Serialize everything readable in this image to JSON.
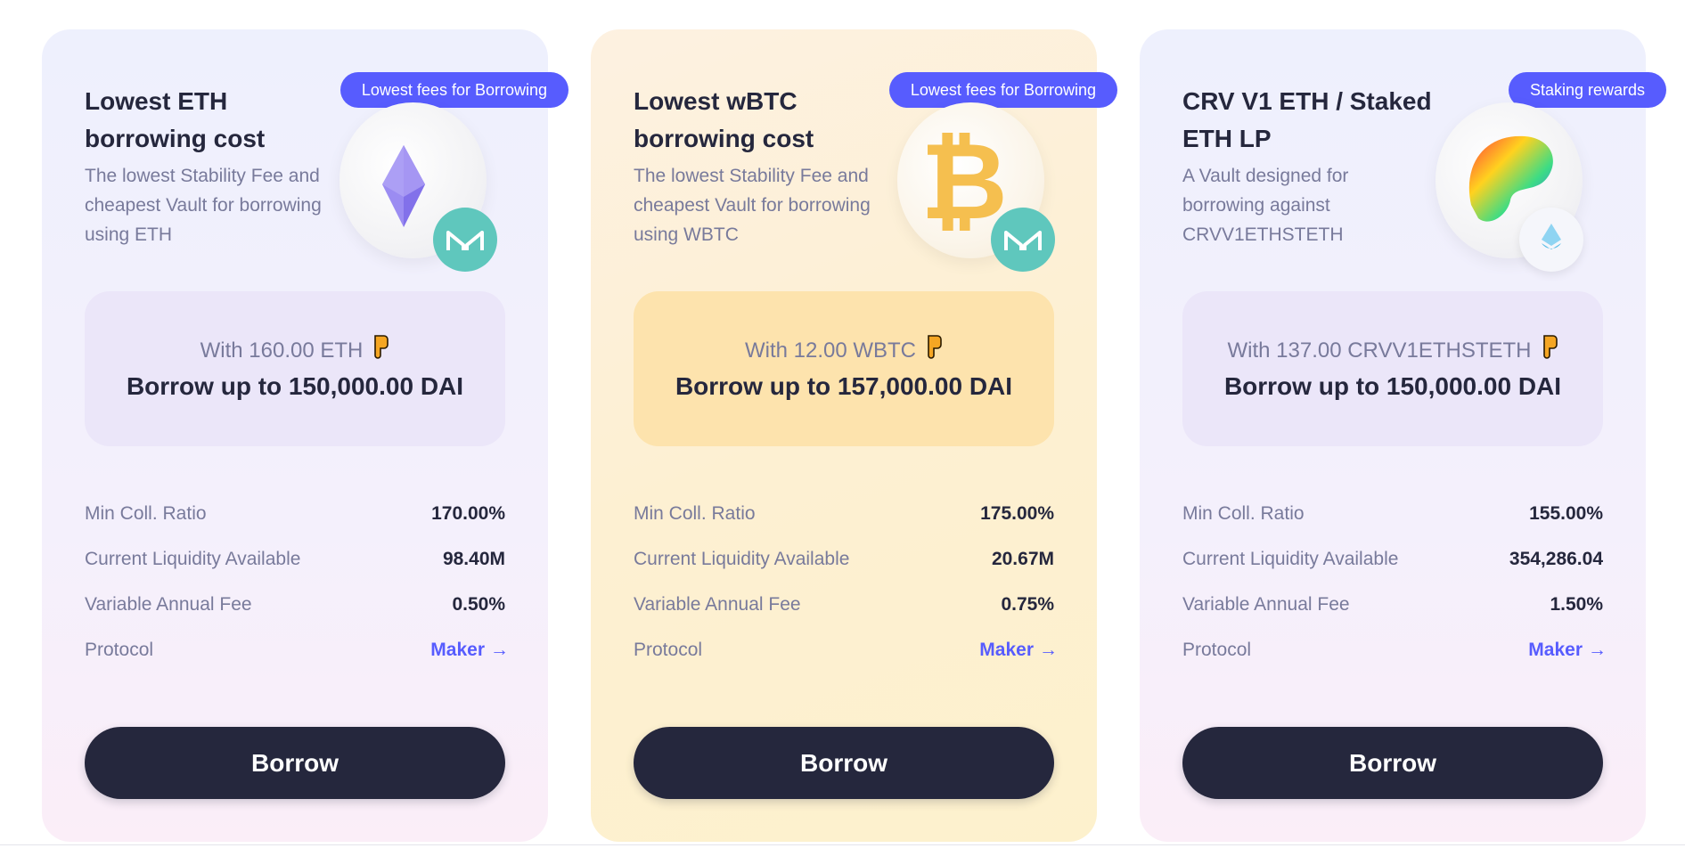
{
  "cards": [
    {
      "badge": "Lowest fees for Borrowing",
      "title": "Lowest ETH borrowing cost",
      "description": "The lowest Stability Fee and cheapest Vault for borrowing using ETH",
      "with_text": "With 160.00 ETH",
      "borrow_text": "Borrow up to 150,000.00 DAI",
      "stats": [
        {
          "label": "Min Coll. Ratio",
          "value": "170.00%"
        },
        {
          "label": "Current Liquidity Available",
          "value": "98.40M"
        },
        {
          "label": "Variable Annual Fee",
          "value": "0.50%"
        },
        {
          "label": "Protocol",
          "value": "Maker"
        }
      ],
      "button": "Borrow",
      "icons": {
        "main": "ethereum-icon",
        "sub": "maker-icon"
      }
    },
    {
      "badge": "Lowest fees for Borrowing",
      "title": "Lowest wBTC borrowing cost",
      "description": "The lowest Stability Fee and cheapest Vault for borrowing using WBTC",
      "with_text": "With 12.00 WBTC",
      "borrow_text": "Borrow up to 157,000.00 DAI",
      "stats": [
        {
          "label": "Min Coll. Ratio",
          "value": "175.00%"
        },
        {
          "label": "Current Liquidity Available",
          "value": "20.67M"
        },
        {
          "label": "Variable Annual Fee",
          "value": "0.75%"
        },
        {
          "label": "Protocol",
          "value": "Maker"
        }
      ],
      "button": "Borrow",
      "icons": {
        "main": "bitcoin-icon",
        "sub": "maker-icon"
      }
    },
    {
      "badge": "Staking rewards",
      "title": "CRV V1 ETH / Staked ETH LP",
      "description": "A Vault designed for borrowing against CRVV1ETHSTETH",
      "with_text": "With 137.00 CRVV1ETHSTETH",
      "borrow_text": "Borrow up to 150,000.00 DAI",
      "stats": [
        {
          "label": "Min Coll. Ratio",
          "value": "155.00%"
        },
        {
          "label": "Current Liquidity Available",
          "value": "354,286.04"
        },
        {
          "label": "Variable Annual Fee",
          "value": "1.50%"
        },
        {
          "label": "Protocol",
          "value": "Maker"
        }
      ],
      "button": "Borrow",
      "icons": {
        "main": "curve-icon",
        "sub": "lido-icon"
      }
    }
  ],
  "colors": {
    "accent": "#575cfe",
    "dark": "#25273d",
    "muted": "#787a9b",
    "maker_teal": "#5fc7bd",
    "hand_emoji": "#f5a623"
  }
}
